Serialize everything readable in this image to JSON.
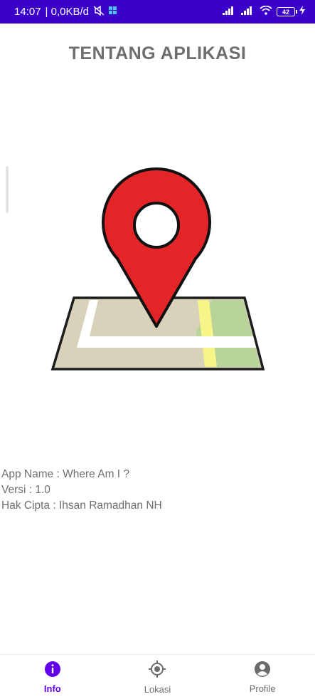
{
  "status_bar": {
    "time": "14:07",
    "network_speed": "| 0,0KB/d",
    "battery_level": "42",
    "icons": [
      "mute-icon",
      "windows-icon",
      "signal-icon",
      "signal-icon",
      "wifi-icon",
      "battery-icon",
      "charging-icon"
    ]
  },
  "header": {
    "title": "TENTANG APLIKASI"
  },
  "illustration": {
    "icon": "map-pin-icon",
    "pin_color": "#e42527"
  },
  "app_info": {
    "name_line": "App Name : Where Am I ?",
    "version_line": "Versi : 1.0",
    "copyright_line": "Hak Cipta : Ihsan Ramadhan NH"
  },
  "bottom_nav": {
    "accent": "#6200ee",
    "items": [
      {
        "label": "Info",
        "icon": "info-icon",
        "active": true
      },
      {
        "label": "Lokasi",
        "icon": "location-target-icon",
        "active": false
      },
      {
        "label": "Profile",
        "icon": "account-icon",
        "active": false
      }
    ]
  }
}
